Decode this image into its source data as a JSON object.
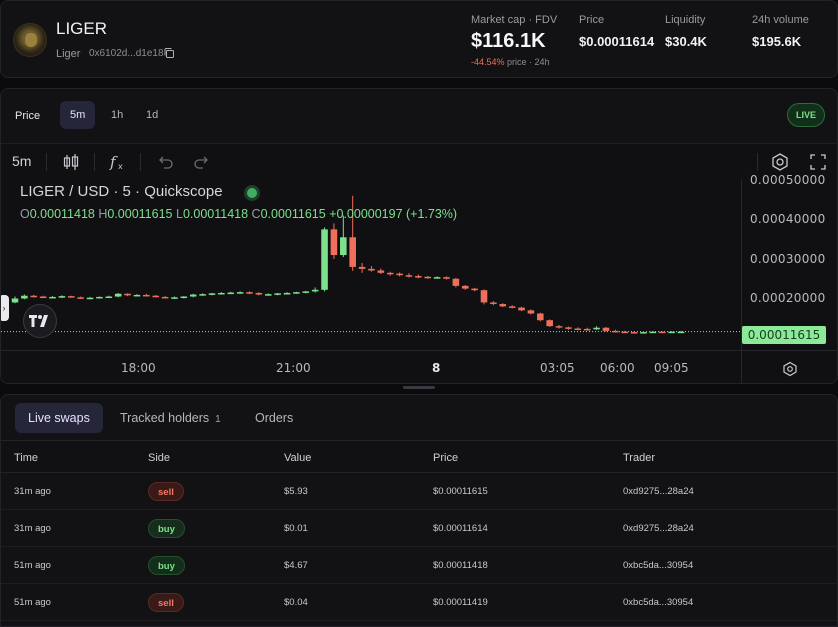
{
  "token": {
    "name": "LIGER",
    "symbol": "Liger",
    "address": "0x6102d...d1e18",
    "avatar_icon": "liger-avatar-icon"
  },
  "stats": {
    "market_cap": {
      "label": "Market cap · FDV",
      "value": "$116.1K",
      "change": "-44.54%",
      "change_suffix": "price · 24h"
    },
    "price": {
      "label": "Price",
      "value": "$0.00011614"
    },
    "liquidity": {
      "label": "Liquidity",
      "value": "$30.4K"
    },
    "volume": {
      "label": "24h volume",
      "value": "$195.6K"
    }
  },
  "chart_panel": {
    "price_label": "Price",
    "timeframes": [
      "5m",
      "1h",
      "1d"
    ],
    "active_timeframe": "5m",
    "live_label": "LIVE",
    "toolbar_interval": "5m",
    "legend_title": "LIGER / USD · 5 · Quickscope",
    "ohlc": {
      "o_key": "O",
      "o": "0.00011418",
      "h_key": "H",
      "h": "0.00011615",
      "l_key": "L",
      "l": "0.00011418",
      "c_key": "C",
      "c": "0.00011615",
      "chg": "+0.00000197 (+1.73%)"
    },
    "current_price_tag": "0.00011615",
    "colors": {
      "up": "#7de08b",
      "down": "#ef6f5a"
    }
  },
  "chart_data": {
    "type": "candlestick",
    "title": "LIGER / USD · 5 · Quickscope",
    "y_ticks": [
      "0.00050000",
      "0.00040000",
      "0.00030000",
      "0.00020000"
    ],
    "x_ticks": [
      "18:00",
      "21:00",
      "8",
      "03:05",
      "06:00",
      "09:05"
    ],
    "ylim": [
      0.0001,
      0.0005
    ],
    "candles": [
      [
        0.00019,
        0.000205,
        0.000188,
        0.0002
      ],
      [
        0.0002,
        0.00021,
        0.000198,
        0.000207
      ],
      [
        0.000207,
        0.000209,
        0.000203,
        0.000205
      ],
      [
        0.000205,
        0.000207,
        0.000201,
        0.000203
      ],
      [
        0.000203,
        0.000206,
        0.0002,
        0.000204
      ],
      [
        0.000204,
        0.000208,
        0.000201,
        0.000206
      ],
      [
        0.000206,
        0.000207,
        0.000202,
        0.000203
      ],
      [
        0.000203,
        0.000205,
        0.000199,
        0.000201
      ],
      [
        0.000201,
        0.000204,
        0.000198,
        0.000202
      ],
      [
        0.000202,
        0.000205,
        0.0002,
        0.000204
      ],
      [
        0.000204,
        0.000207,
        0.000202,
        0.000205
      ],
      [
        0.000205,
        0.000214,
        0.000203,
        0.000212
      ],
      [
        0.000212,
        0.000213,
        0.000206,
        0.000208
      ],
      [
        0.000208,
        0.000211,
        0.000205,
        0.000209
      ],
      [
        0.000209,
        0.000212,
        0.000206,
        0.000207
      ],
      [
        0.000207,
        0.000209,
        0.000203,
        0.000204
      ],
      [
        0.000204,
        0.000206,
        0.0002,
        0.000202
      ],
      [
        0.000202,
        0.000205,
        0.000199,
        0.000203
      ],
      [
        0.000203,
        0.000206,
        0.0002,
        0.000205
      ],
      [
        0.000205,
        0.000212,
        0.000203,
        0.00021
      ],
      [
        0.00021,
        0.000213,
        0.000207,
        0.000211
      ],
      [
        0.000211,
        0.000214,
        0.000208,
        0.000213
      ],
      [
        0.000213,
        0.000216,
        0.00021,
        0.000214
      ],
      [
        0.000214,
        0.000217,
        0.000211,
        0.000215
      ],
      [
        0.000215,
        0.000218,
        0.000212,
        0.000216
      ],
      [
        0.000216,
        0.000218,
        0.000211,
        0.000214
      ],
      [
        0.000214,
        0.000216,
        0.000208,
        0.00021
      ],
      [
        0.00021,
        0.000213,
        0.000207,
        0.000211
      ],
      [
        0.000211,
        0.000214,
        0.000208,
        0.000213
      ],
      [
        0.000213,
        0.000216,
        0.00021,
        0.000214
      ],
      [
        0.000214,
        0.000217,
        0.000212,
        0.000216
      ],
      [
        0.000216,
        0.000219,
        0.000213,
        0.000218
      ],
      [
        0.000218,
        0.000228,
        0.000215,
        0.000222
      ],
      [
        0.000222,
        0.00038,
        0.000218,
        0.000375
      ],
      [
        0.000375,
        0.00039,
        0.0003,
        0.00031
      ],
      [
        0.00031,
        0.00041,
        0.000305,
        0.000355
      ],
      [
        0.000355,
        0.00046,
        0.00027,
        0.00028
      ],
      [
        0.00028,
        0.00029,
        0.000265,
        0.000275
      ],
      [
        0.000275,
        0.000282,
        0.000268,
        0.000271
      ],
      [
        0.000271,
        0.000276,
        0.000262,
        0.000265
      ],
      [
        0.000265,
        0.000268,
        0.000258,
        0.000263
      ],
      [
        0.000263,
        0.000266,
        0.000256,
        0.000259
      ],
      [
        0.000259,
        0.000264,
        0.000253,
        0.000257
      ],
      [
        0.000257,
        0.000261,
        0.000251,
        0.000255
      ],
      [
        0.000255,
        0.000257,
        0.00025,
        0.000252
      ],
      [
        0.000252,
        0.000256,
        0.00025,
        0.000254
      ],
      [
        0.000254,
        0.000256,
        0.000248,
        0.00025
      ],
      [
        0.00025,
        0.000252,
        0.000228,
        0.000232
      ],
      [
        0.000232,
        0.000234,
        0.000222,
        0.000225
      ],
      [
        0.000225,
        0.000227,
        0.000218,
        0.000221
      ],
      [
        0.000221,
        0.000223,
        0.000185,
        0.00019
      ],
      [
        0.00019,
        0.000193,
        0.000183,
        0.000186
      ],
      [
        0.000186,
        0.000188,
        0.000178,
        0.00018
      ],
      [
        0.00018,
        0.000183,
        0.000175,
        0.000177
      ],
      [
        0.000177,
        0.000179,
        0.000168,
        0.00017
      ],
      [
        0.00017,
        0.000172,
        0.00016,
        0.000162
      ],
      [
        0.000162,
        0.000164,
        0.000142,
        0.000145
      ],
      [
        0.000145,
        0.000147,
        0.000128,
        0.00013
      ],
      [
        0.00013,
        0.000133,
        0.000124,
        0.000127
      ],
      [
        0.000127,
        0.000129,
        0.000121,
        0.000124
      ],
      [
        0.000124,
        0.000127,
        0.00012,
        0.000123
      ],
      [
        0.000123,
        0.000126,
        0.000119,
        0.000122
      ],
      [
        0.000122,
        0.00013,
        0.00012,
        0.000126
      ],
      [
        0.000126,
        0.000128,
        0.000116,
        0.000118
      ],
      [
        0.000118,
        0.000121,
        0.000114,
        0.000116
      ],
      [
        0.000116,
        0.000118,
        0.000113,
        0.000115
      ],
      [
        0.000115,
        0.000117,
        0.000112,
        0.000114
      ],
      [
        0.000114,
        0.000116,
        0.000112,
        0.000115
      ],
      [
        0.000115,
        0.000117,
        0.000113,
        0.000116
      ],
      [
        0.000116,
        0.000117,
        0.000113,
        0.000114
      ],
      [
        0.000114,
        0.000117,
        0.000113,
        0.000116
      ],
      [
        0.000116,
        0.000118,
        0.000114,
        0.000116
      ]
    ]
  },
  "swaps_panel": {
    "tabs": [
      {
        "label": "Live swaps",
        "count": ""
      },
      {
        "label": "Tracked holders",
        "count": "1"
      },
      {
        "label": "Orders",
        "count": ""
      }
    ],
    "columns": [
      "Time",
      "Side",
      "Value",
      "Price",
      "Trader"
    ],
    "rows": [
      {
        "time": "31m ago",
        "side": "sell",
        "value": "$5.93",
        "price": "$0.00011615",
        "trader": "0xd9275...28a24"
      },
      {
        "time": "31m ago",
        "side": "buy",
        "value": "$0.01",
        "price": "$0.00011614",
        "trader": "0xd9275...28a24"
      },
      {
        "time": "51m ago",
        "side": "buy",
        "value": "$4.67",
        "price": "$0.00011418",
        "trader": "0xbc5da...30954"
      },
      {
        "time": "51m ago",
        "side": "sell",
        "value": "$0.04",
        "price": "$0.00011419",
        "trader": "0xbc5da...30954"
      }
    ]
  }
}
